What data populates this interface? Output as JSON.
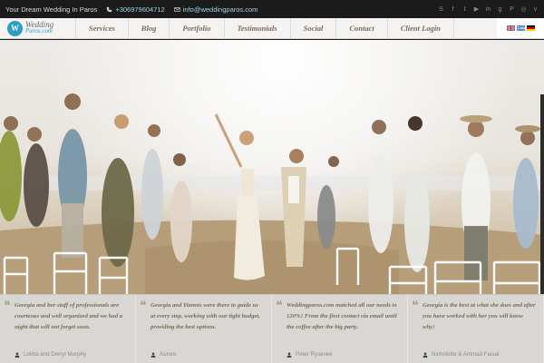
{
  "topbar": {
    "tagline": "Your Dream Wedding In Paros",
    "phone": "+306979604712",
    "email": "info@weddingparos.com",
    "social_icons": [
      "skype-icon",
      "facebook-icon",
      "twitter-icon",
      "youtube-icon",
      "linkedin-icon",
      "google-plus-icon",
      "pinterest-icon",
      "instagram-icon",
      "vimeo-icon"
    ]
  },
  "nav": {
    "logo_word1": "Wedding",
    "logo_word2": "Paros.com",
    "logo_mark": "W",
    "items": [
      {
        "label": "Services"
      },
      {
        "label": "Blog"
      },
      {
        "label": "Portfolio"
      },
      {
        "label": "Testimonials"
      },
      {
        "label": "Social"
      },
      {
        "label": "Contact"
      },
      {
        "label": "Client Login"
      }
    ],
    "flags": [
      "uk-flag",
      "greek-flag",
      "german-flag"
    ]
  },
  "testimonials": [
    {
      "text": "Georgia and her staff of professionals are courteous and well organized and we had a night that will not forget soon.",
      "author": "Lolitta and Derryl Murphy"
    },
    {
      "text": "Georgia and Yiannis were there to guide us at every step, working with our tight budget, providing the best options.",
      "author": "Aurore"
    },
    {
      "text": "Weddingparos.com matched all our needs to 120%! From the first contact via email until the coffee after the big party.",
      "author": "Peter Rysenek"
    },
    {
      "text": "Georgia is the best at what she does and after you have worked with her you will know why!",
      "author": "Nicholette & Ammad Faisal"
    }
  ],
  "colors": {
    "accent": "#2c9cc4",
    "nav_text": "#7a6a58",
    "topbar_bg": "#1b1b1b"
  }
}
